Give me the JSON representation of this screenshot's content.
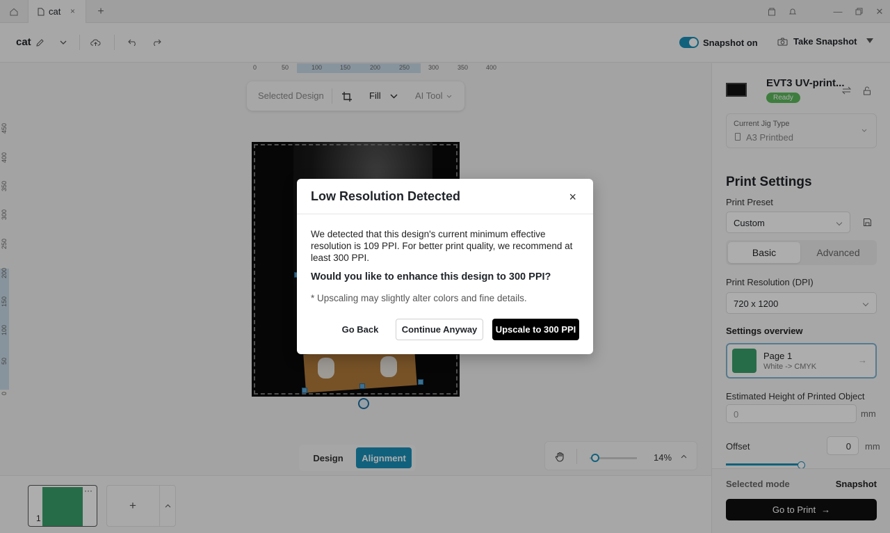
{
  "titlebar": {
    "tab_label": "cat",
    "tab_close": "×",
    "add_tab": "+"
  },
  "toolbar": {
    "doc_name": "cat",
    "snapshot_label": "Snapshot on",
    "snapshot_enabled": true,
    "take_snapshot_label": "Take Snapshot"
  },
  "canvas": {
    "ruler_top": [
      "0",
      "50",
      "100",
      "150",
      "200",
      "250",
      "300",
      "350",
      "400"
    ],
    "ruler_left": [
      "450",
      "400",
      "350",
      "300",
      "250",
      "200",
      "150",
      "100",
      "50",
      "0"
    ],
    "floatbar": {
      "selected_design": "Selected Design",
      "fill": "Fill",
      "ai_tool": "AI Tool"
    },
    "mode_tabs": {
      "design": "Design",
      "alignment": "Alignment",
      "active": "Alignment"
    },
    "zoom": {
      "value_label": "14%",
      "slider_value": 0.14
    }
  },
  "pages": {
    "thumb_number": "1",
    "thumb_more": "···",
    "add_page": "+"
  },
  "right_panel": {
    "printer_name": "EVT3 UV-print...",
    "printer_status": "Ready",
    "jig_label": "Current Jig Type",
    "jig_value": "A3 Printbed",
    "print_settings_title": "Print Settings",
    "print_preset_label": "Print Preset",
    "print_preset_value": "Custom",
    "tabs": {
      "basic": "Basic",
      "advanced": "Advanced",
      "active": "Basic"
    },
    "resolution_label": "Print Resolution (DPI)",
    "resolution_value": "720 x 1200",
    "overview_label": "Settings overview",
    "page_card_title": "Page 1",
    "page_card_sub": "White -> CMYK",
    "est_height_label": "Estimated Height of Printed Object",
    "est_height_placeholder": "0",
    "est_height_unit": "mm",
    "offset_label": "Offset",
    "offset_value": "0",
    "offset_unit": "mm",
    "selected_mode_label": "Selected mode",
    "selected_mode_value": "Snapshot",
    "go_to_print": "Go to Print"
  },
  "modal": {
    "title": "Low Resolution Detected",
    "close": "×",
    "body": "We detected that this design's current minimum effective resolution is 109 PPI. For better print quality, we recommend at least 300 PPI.",
    "question": "Would you like to enhance this design to 300 PPI?",
    "note": "* Upscaling may slightly alter colors and fine details.",
    "btn_back": "Go Back",
    "btn_continue": "Continue Anyway",
    "btn_upscale": "Upscale to 300 PPI"
  },
  "colors": {
    "accent": "#1a8fb8",
    "ready_badge": "#5cb85c",
    "primary_button": "#000000"
  }
}
